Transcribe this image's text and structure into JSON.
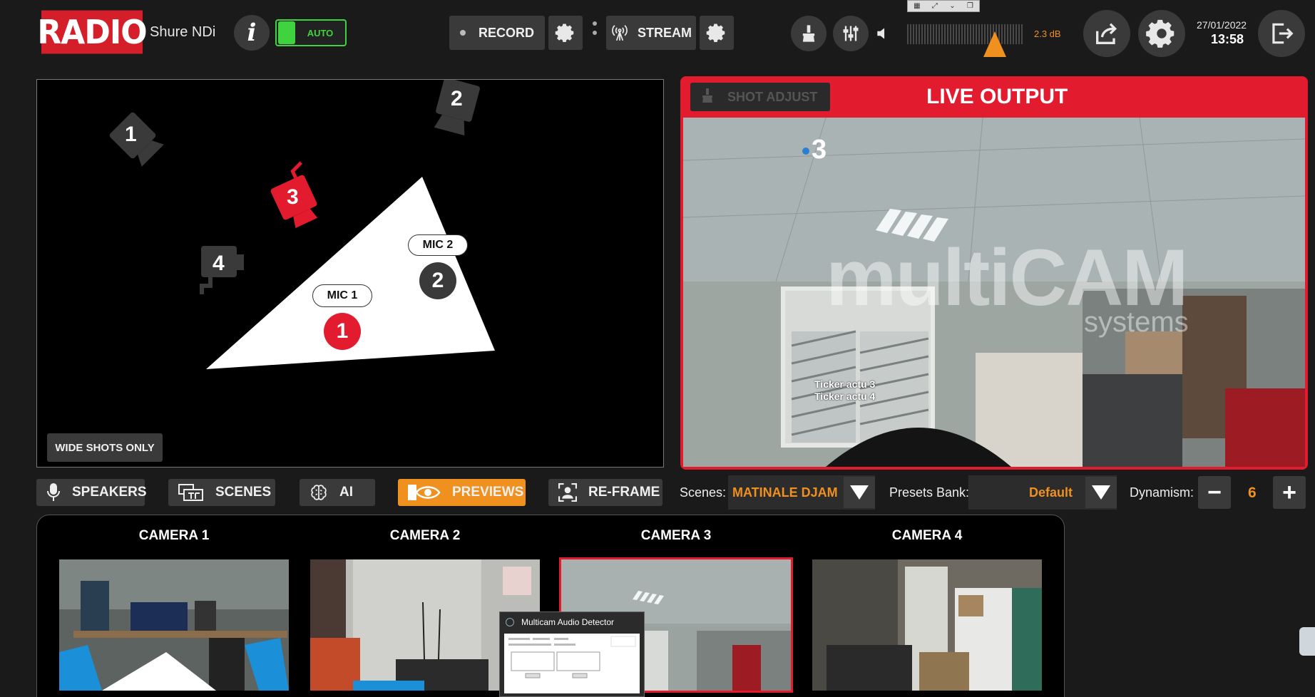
{
  "header": {
    "logo": "RADIO",
    "device_name": "Shure NDi",
    "auto_label": "AUTO",
    "record_label": "RECORD",
    "stream_label": "STREAM",
    "audio_level": "2.3 dB",
    "date": "27/01/2022",
    "time": "13:58"
  },
  "map": {
    "cameras": [
      "1",
      "2",
      "3",
      "4"
    ],
    "mics": [
      {
        "label": "MIC 1",
        "number": "1"
      },
      {
        "label": "MIC 2",
        "number": "2"
      }
    ],
    "wide_shots_label": "WIDE SHOTS ONLY"
  },
  "live": {
    "shot_adjust_label": "SHOT ADJUST",
    "title": "LIVE OUTPUT",
    "camera_number": "3",
    "watermark": "multiCAM",
    "watermark_sub": "systems",
    "tickers": [
      "Ticker actu 3",
      "Ticker actu 4"
    ]
  },
  "modes": {
    "speakers": "SPEAKERS",
    "scenes": "SCENES",
    "ai": "AI",
    "previews": "PREVIEWS",
    "reframe": "RE-FRAME"
  },
  "controls": {
    "scenes_label": "Scenes:",
    "scenes_value": "MATINALE DJAM",
    "presets_label": "Presets Bank:",
    "presets_value": "Default",
    "dynamism_label": "Dynamism:",
    "dynamism_value": "6",
    "minus": "−",
    "plus": "+"
  },
  "previews": {
    "cameras": [
      "CAMERA 1",
      "CAMERA 2",
      "CAMERA 3",
      "CAMERA 4"
    ],
    "selected": "CAMERA 3"
  },
  "popup": {
    "title": "Multicam Audio Detector"
  },
  "colors": {
    "accent_red": "#e31b2f",
    "accent_orange": "#f0901e",
    "auto_green": "#3fd33f",
    "button_bg": "#3a3a3a"
  }
}
